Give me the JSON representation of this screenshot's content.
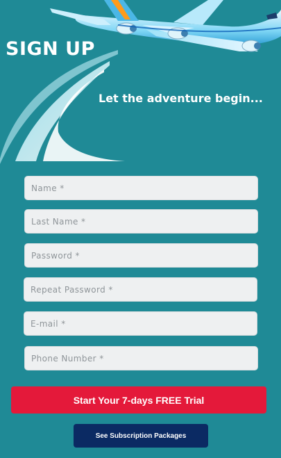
{
  "page": {
    "title": "SIGN UP",
    "tagline": "Let the adventure begin..."
  },
  "form": {
    "fields": [
      {
        "placeholder": "Name *",
        "value": ""
      },
      {
        "placeholder": "Last Name *",
        "value": ""
      },
      {
        "placeholder": "Password *",
        "value": ""
      },
      {
        "placeholder": "Repeat Password *",
        "value": ""
      },
      {
        "placeholder": "E-mail *",
        "value": ""
      },
      {
        "placeholder": "Phone Number *",
        "value": ""
      }
    ]
  },
  "actions": {
    "trial_label": "Start Your 7-days FREE Trial",
    "packages_label": "See Subscription Packages"
  },
  "colors": {
    "background": "#1f8a96",
    "primary_button": "#e4193a",
    "secondary_button": "#0b2a63"
  },
  "icons": [
    "airplane-icon",
    "swoosh-graphic"
  ]
}
